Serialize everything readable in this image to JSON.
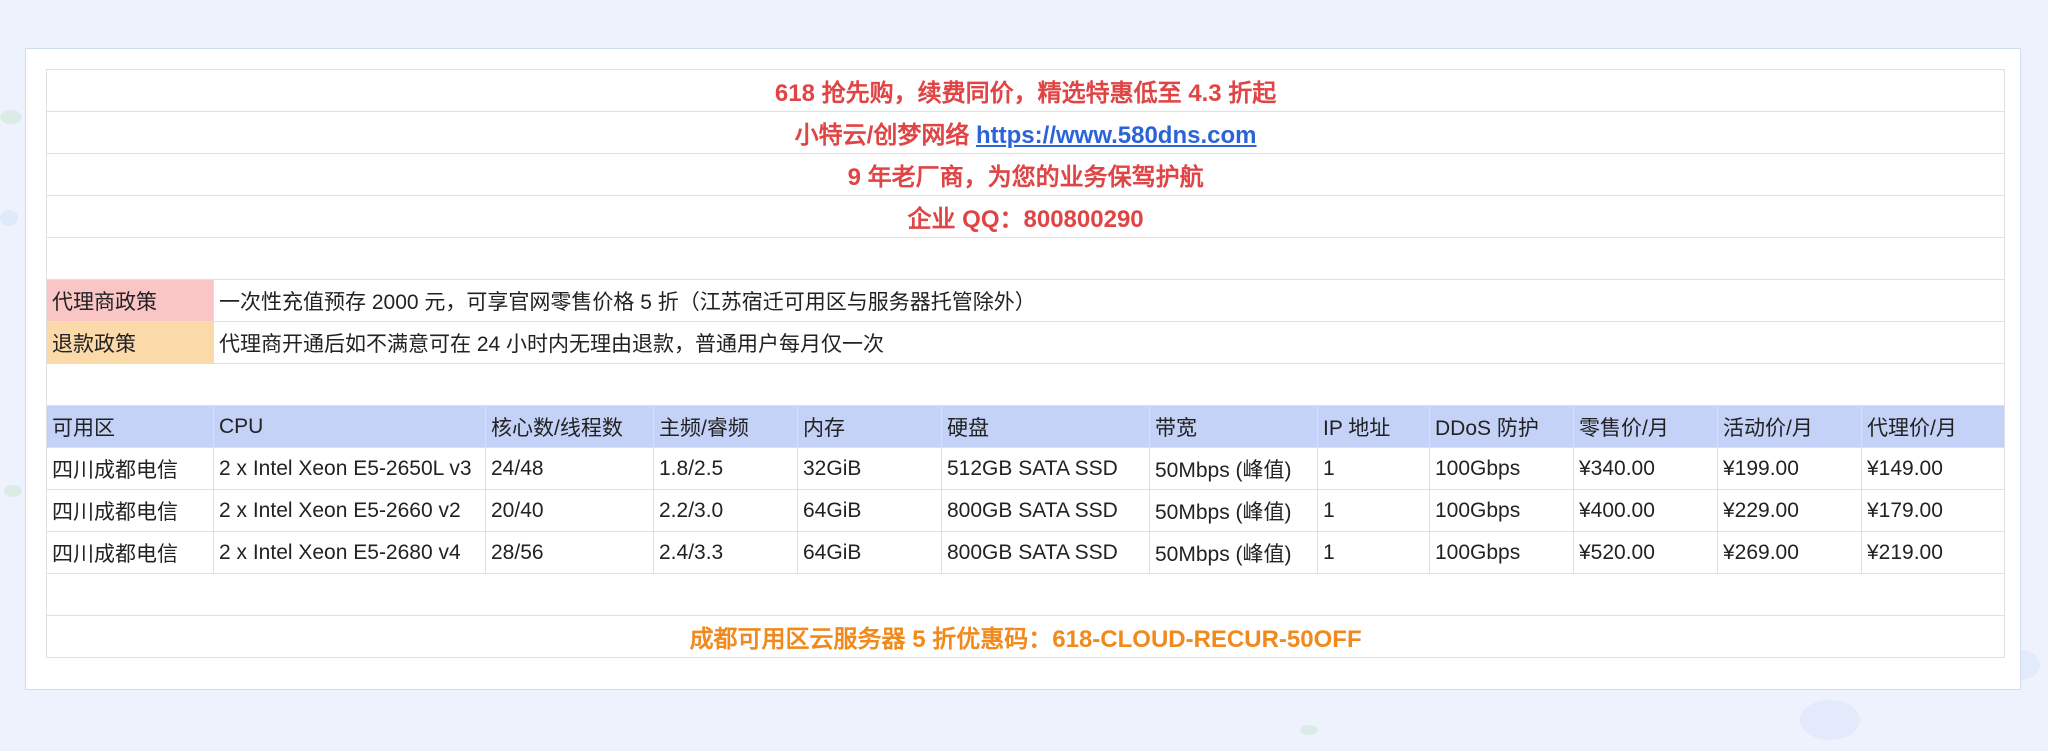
{
  "banner": {
    "line1": "618 抢先购，续费同价，精选特惠低至 4.3 折起",
    "line2_prefix": "小特云/创梦网络 ",
    "line2_link": "https://www.580dns.com",
    "line3": "9 年老厂商，为您的业务保驾护航",
    "line4": "企业 QQ：800800290"
  },
  "policies": [
    {
      "label": "代理商政策",
      "text": "一次性充值预存 2000 元，可享官网零售价格 5 折（江苏宿迁可用区与服务器托管除外）"
    },
    {
      "label": "退款政策",
      "text": "代理商开通后如不满意可在 24 小时内无理由退款，普通用户每月仅一次"
    }
  ],
  "table": {
    "headers": [
      "可用区",
      "CPU",
      "核心数/线程数",
      "主频/睿频",
      "内存",
      "硬盘",
      "带宽",
      "IP 地址",
      "DDoS 防护",
      "零售价/月",
      "活动价/月",
      "代理价/月"
    ],
    "rows": [
      [
        "四川成都电信",
        "2 x Intel Xeon E5-2650L v3",
        "24/48",
        "1.8/2.5",
        "32GiB",
        "512GB SATA SSD",
        "50Mbps (峰值)",
        "1",
        "100Gbps",
        "¥340.00",
        "¥199.00",
        "¥149.00"
      ],
      [
        "四川成都电信",
        "2 x Intel Xeon E5-2660 v2",
        "20/40",
        "2.2/3.0",
        "64GiB",
        "800GB SATA SSD",
        "50Mbps (峰值)",
        "1",
        "100Gbps",
        "¥400.00",
        "¥229.00",
        "¥179.00"
      ],
      [
        "四川成都电信",
        "2 x Intel Xeon E5-2680 v4",
        "28/56",
        "2.4/3.3",
        "64GiB",
        "800GB SATA SSD",
        "50Mbps (峰值)",
        "1",
        "100Gbps",
        "¥520.00",
        "¥269.00",
        "¥219.00"
      ]
    ]
  },
  "footer": {
    "promo": "成都可用区云服务器 5 折优惠码：618-CLOUD-RECUR-50OFF"
  },
  "colors": {
    "banner_red": "#e04444",
    "link_blue": "#2c64d8",
    "label_red_bg": "#f9c5c5",
    "label_orange_bg": "#fbd9a9",
    "header_bg": "#c4d2f7",
    "promo_orange": "#f08a1d"
  }
}
